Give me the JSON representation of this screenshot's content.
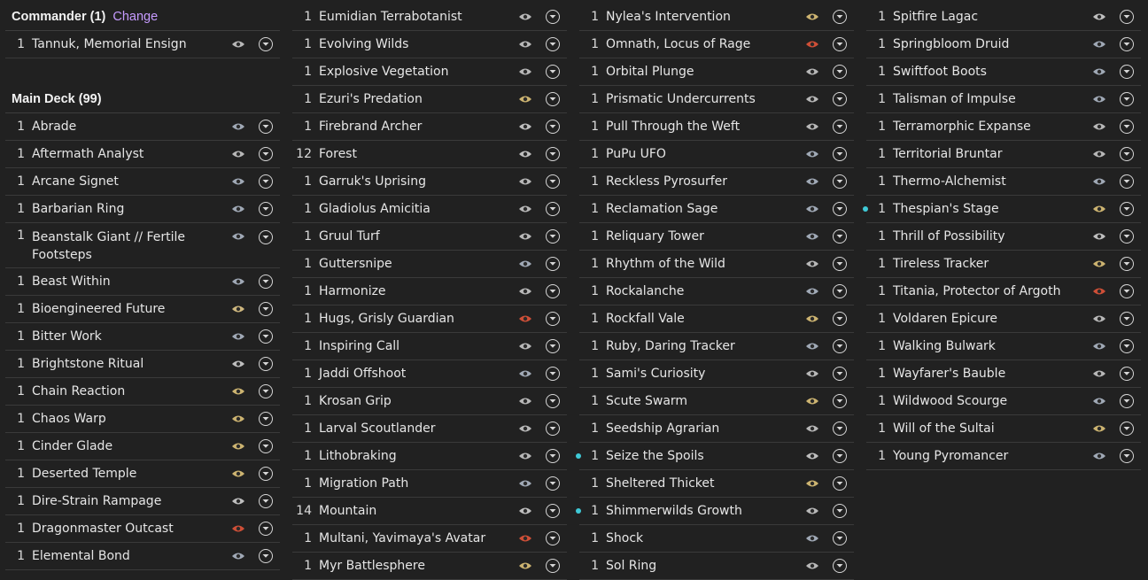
{
  "commander": {
    "header": "Commander (1)",
    "change_label": "Change",
    "cards": [
      {
        "qty": "1",
        "name": "Tannuk, Memorial Ensign",
        "set_icon": "planeswalker-swirl-icon",
        "color": "#c9c9c9"
      }
    ]
  },
  "main": {
    "header": "Main Deck (99)",
    "col1": [
      {
        "qty": "1",
        "name": "Abrade",
        "set_icon": "set-icon",
        "color": "#aeb8c6"
      },
      {
        "qty": "1",
        "name": "Aftermath Analyst",
        "set_icon": "set-icon",
        "color": "#c9c9c9"
      },
      {
        "qty": "1",
        "name": "Arcane Signet",
        "set_icon": "set-icon",
        "color": "#aeb8c6"
      },
      {
        "qty": "1",
        "name": "Barbarian Ring",
        "set_icon": "set-icon",
        "color": "#aeb8c6"
      },
      {
        "qty": "1",
        "name": "Beanstalk Giant // Fertile Footsteps",
        "set_icon": "set-icon",
        "color": "#aeb8c6",
        "tall": true
      },
      {
        "qty": "1",
        "name": "Beast Within",
        "set_icon": "set-icon",
        "color": "#aeb8c6"
      },
      {
        "qty": "1",
        "name": "Bioengineered Future",
        "set_icon": "set-icon",
        "color": "#e2c98a"
      },
      {
        "qty": "1",
        "name": "Bitter Work",
        "set_icon": "set-icon",
        "color": "#aeb8c6"
      },
      {
        "qty": "1",
        "name": "Brightstone Ritual",
        "set_icon": "set-icon",
        "color": "#d0d0d0"
      },
      {
        "qty": "1",
        "name": "Chain Reaction",
        "set_icon": "set-icon",
        "color": "#e0c47a"
      },
      {
        "qty": "1",
        "name": "Chaos Warp",
        "set_icon": "set-icon",
        "color": "#e0c47a"
      },
      {
        "qty": "1",
        "name": "Cinder Glade",
        "set_icon": "set-icon",
        "color": "#e0c47a"
      },
      {
        "qty": "1",
        "name": "Deserted Temple",
        "set_icon": "set-icon",
        "color": "#e0c47a"
      },
      {
        "qty": "1",
        "name": "Dire-Strain Rampage",
        "set_icon": "set-icon",
        "color": "#d0d0d0"
      },
      {
        "qty": "1",
        "name": "Dragonmaster Outcast",
        "set_icon": "set-icon",
        "color": "#e2543a"
      },
      {
        "qty": "1",
        "name": "Elemental Bond",
        "set_icon": "set-icon",
        "color": "#aeb8c6"
      }
    ],
    "col2": [
      {
        "qty": "1",
        "name": "Eumidian Terrabotanist",
        "set_icon": "set-icon",
        "color": "#c9c9c9"
      },
      {
        "qty": "1",
        "name": "Evolving Wilds",
        "set_icon": "set-icon",
        "color": "#c9c9c9"
      },
      {
        "qty": "1",
        "name": "Explosive Vegetation",
        "set_icon": "set-icon",
        "color": "#c9c9c9"
      },
      {
        "qty": "1",
        "name": "Ezuri's Predation",
        "set_icon": "set-icon",
        "color": "#e0c47a"
      },
      {
        "qty": "1",
        "name": "Firebrand Archer",
        "set_icon": "set-icon",
        "color": "#d0d0d0"
      },
      {
        "qty": "12",
        "name": "Forest",
        "set_icon": "set-icon",
        "color": "#d0d0d0"
      },
      {
        "qty": "1",
        "name": "Garruk's Uprising",
        "set_icon": "set-icon",
        "color": "#c9c9c9"
      },
      {
        "qty": "1",
        "name": "Gladiolus Amicitia",
        "set_icon": "set-icon",
        "color": "#c9c9c9"
      },
      {
        "qty": "1",
        "name": "Gruul Turf",
        "set_icon": "set-icon",
        "color": "#c9c9c9"
      },
      {
        "qty": "1",
        "name": "Guttersnipe",
        "set_icon": "set-icon",
        "color": "#aeb8c6"
      },
      {
        "qty": "1",
        "name": "Harmonize",
        "set_icon": "set-icon",
        "color": "#c9c9c9"
      },
      {
        "qty": "1",
        "name": "Hugs, Grisly Guardian",
        "set_icon": "set-icon",
        "color": "#e2543a"
      },
      {
        "qty": "1",
        "name": "Inspiring Call",
        "set_icon": "set-icon",
        "color": "#c9c9c9"
      },
      {
        "qty": "1",
        "name": "Jaddi Offshoot",
        "set_icon": "set-icon",
        "color": "#aeb8c6"
      },
      {
        "qty": "1",
        "name": "Krosan Grip",
        "set_icon": "set-icon",
        "color": "#c9c9c9"
      },
      {
        "qty": "1",
        "name": "Larval Scoutlander",
        "set_icon": "set-icon",
        "color": "#c9c9c9"
      },
      {
        "qty": "1",
        "name": "Lithobraking",
        "set_icon": "set-icon",
        "color": "#c9c9c9"
      },
      {
        "qty": "1",
        "name": "Migration Path",
        "set_icon": "set-icon",
        "color": "#aeb8c6"
      },
      {
        "qty": "14",
        "name": "Mountain",
        "set_icon": "set-icon",
        "color": "#d0d0d0"
      },
      {
        "qty": "1",
        "name": "Multani, Yavimaya's Avatar",
        "set_icon": "set-icon",
        "color": "#e2543a"
      },
      {
        "qty": "1",
        "name": "Myr Battlesphere",
        "set_icon": "set-icon",
        "color": "#e0c47a"
      }
    ],
    "col3": [
      {
        "qty": "1",
        "name": "Nylea's Intervention",
        "set_icon": "set-icon",
        "color": "#e0c47a"
      },
      {
        "qty": "1",
        "name": "Omnath, Locus of Rage",
        "set_icon": "set-icon",
        "color": "#e2543a"
      },
      {
        "qty": "1",
        "name": "Orbital Plunge",
        "set_icon": "set-icon",
        "color": "#c9c9c9"
      },
      {
        "qty": "1",
        "name": "Prismatic Undercurrents",
        "set_icon": "set-icon",
        "color": "#c9c9c9"
      },
      {
        "qty": "1",
        "name": "Pull Through the Weft",
        "set_icon": "set-icon",
        "color": "#c9c9c9"
      },
      {
        "qty": "1",
        "name": "PuPu UFO",
        "set_icon": "set-icon",
        "color": "#aeb8c6"
      },
      {
        "qty": "1",
        "name": "Reckless Pyrosurfer",
        "set_icon": "set-icon",
        "color": "#aeb8c6"
      },
      {
        "qty": "1",
        "name": "Reclamation Sage",
        "set_icon": "set-icon",
        "color": "#aeb8c6"
      },
      {
        "qty": "1",
        "name": "Reliquary Tower",
        "set_icon": "set-icon",
        "color": "#aeb8c6"
      },
      {
        "qty": "1",
        "name": "Rhythm of the Wild",
        "set_icon": "set-icon",
        "color": "#c9c9c9"
      },
      {
        "qty": "1",
        "name": "Rockalanche",
        "set_icon": "set-icon",
        "color": "#aeb8c6"
      },
      {
        "qty": "1",
        "name": "Rockfall Vale",
        "set_icon": "set-icon",
        "color": "#e0c47a"
      },
      {
        "qty": "1",
        "name": "Ruby, Daring Tracker",
        "set_icon": "set-icon",
        "color": "#aeb8c6"
      },
      {
        "qty": "1",
        "name": "Sami's Curiosity",
        "set_icon": "set-icon",
        "color": "#c9c9c9"
      },
      {
        "qty": "1",
        "name": "Scute Swarm",
        "set_icon": "set-icon",
        "color": "#e0c47a"
      },
      {
        "qty": "1",
        "name": "Seedship Agrarian",
        "set_icon": "set-icon",
        "color": "#c9c9c9"
      },
      {
        "qty": "1",
        "name": "Seize the Spoils",
        "set_icon": "set-icon",
        "color": "#d0d0d0",
        "dot": true
      },
      {
        "qty": "1",
        "name": "Sheltered Thicket",
        "set_icon": "set-icon",
        "color": "#e0c47a"
      },
      {
        "qty": "1",
        "name": "Shimmerwilds Growth",
        "set_icon": "set-icon",
        "color": "#c9c9c9",
        "dot": true
      },
      {
        "qty": "1",
        "name": "Shock",
        "set_icon": "set-icon",
        "color": "#aeb8c6"
      },
      {
        "qty": "1",
        "name": "Sol Ring",
        "set_icon": "set-icon",
        "color": "#c9c9c9"
      }
    ],
    "col4": [
      {
        "qty": "1",
        "name": "Spitfire Lagac",
        "set_icon": "set-icon",
        "color": "#d0d0d0"
      },
      {
        "qty": "1",
        "name": "Springbloom Druid",
        "set_icon": "set-icon",
        "color": "#aeb8c6"
      },
      {
        "qty": "1",
        "name": "Swiftfoot Boots",
        "set_icon": "set-icon",
        "color": "#aeb8c6"
      },
      {
        "qty": "1",
        "name": "Talisman of Impulse",
        "set_icon": "set-icon",
        "color": "#aeb8c6"
      },
      {
        "qty": "1",
        "name": "Terramorphic Expanse",
        "set_icon": "set-icon",
        "color": "#c9c9c9"
      },
      {
        "qty": "1",
        "name": "Territorial Bruntar",
        "set_icon": "set-icon",
        "color": "#c9c9c9"
      },
      {
        "qty": "1",
        "name": "Thermo-Alchemist",
        "set_icon": "set-icon",
        "color": "#aeb8c6"
      },
      {
        "qty": "1",
        "name": "Thespian's Stage",
        "set_icon": "set-icon",
        "color": "#e0c47a",
        "dot": true
      },
      {
        "qty": "1",
        "name": "Thrill of Possibility",
        "set_icon": "set-icon",
        "color": "#d0d0d0"
      },
      {
        "qty": "1",
        "name": "Tireless Tracker",
        "set_icon": "set-icon",
        "color": "#e0c47a"
      },
      {
        "qty": "1",
        "name": "Titania, Protector of Argoth",
        "set_icon": "set-icon",
        "color": "#e2543a"
      },
      {
        "qty": "1",
        "name": "Voldaren Epicure",
        "set_icon": "set-icon",
        "color": "#c9c9c9"
      },
      {
        "qty": "1",
        "name": "Walking Bulwark",
        "set_icon": "set-icon",
        "color": "#aeb8c6"
      },
      {
        "qty": "1",
        "name": "Wayfarer's Bauble",
        "set_icon": "set-icon",
        "color": "#c9c9c9"
      },
      {
        "qty": "1",
        "name": "Wildwood Scourge",
        "set_icon": "set-icon",
        "color": "#aeb8c6"
      },
      {
        "qty": "1",
        "name": "Will of the Sultai",
        "set_icon": "set-icon",
        "color": "#e0c47a"
      },
      {
        "qty": "1",
        "name": "Young Pyromancer",
        "set_icon": "set-icon",
        "color": "#aeb8c6"
      }
    ]
  }
}
